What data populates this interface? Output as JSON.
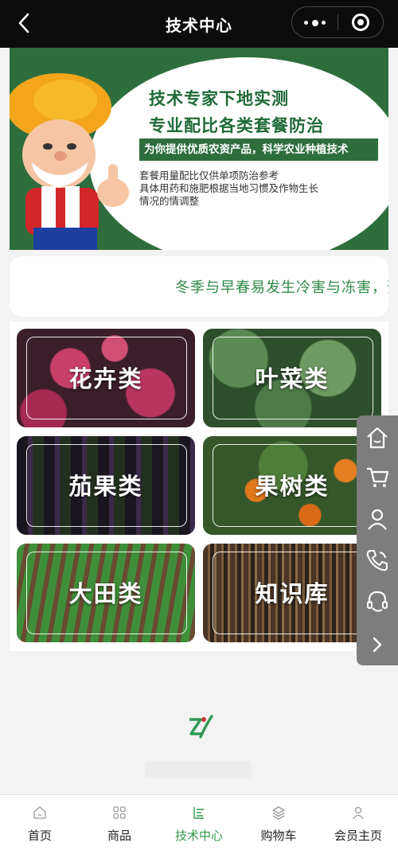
{
  "header": {
    "title": "技术中心",
    "back_icon": "chevron-left-icon",
    "more_icon": "more-dots-icon",
    "close_icon": "target-circle-icon"
  },
  "banner": {
    "headline_1": "技术专家下地实测",
    "headline_2": "专业配比各类套餐防治",
    "tagline": "为你提供优质农资产品，科学农业种植技术",
    "note_1": "套餐用量配比仅供单项防治参考",
    "note_2": "具体用药和施肥根据当地习惯及作物生长",
    "note_3": "情况的情调整",
    "colors": {
      "green": "#2e6e3d",
      "text_green": "#1f6a37"
    }
  },
  "notice": {
    "text": "冬季与早春易发生冷害与冻害，预",
    "color": "#2f8a47"
  },
  "categories": [
    {
      "label": "花卉类"
    },
    {
      "label": "叶菜类"
    },
    {
      "label": "茄果类"
    },
    {
      "label": "果树类"
    },
    {
      "label": "大田类"
    },
    {
      "label": "知识库"
    }
  ],
  "side_menu": {
    "icons": [
      "home-icon",
      "cart-icon",
      "user-icon",
      "phone-icon",
      "headset-icon",
      "chevron-right-icon"
    ]
  },
  "tabbar": {
    "active_color": "#2f9a45",
    "items": [
      {
        "label": "首页",
        "icon": "home-icon"
      },
      {
        "label": "商品",
        "icon": "grid-icon"
      },
      {
        "label": "技术中心",
        "icon": "document-icon"
      },
      {
        "label": "购物车",
        "icon": "layers-icon"
      },
      {
        "label": "会员主页",
        "icon": "user-icon"
      }
    ]
  }
}
